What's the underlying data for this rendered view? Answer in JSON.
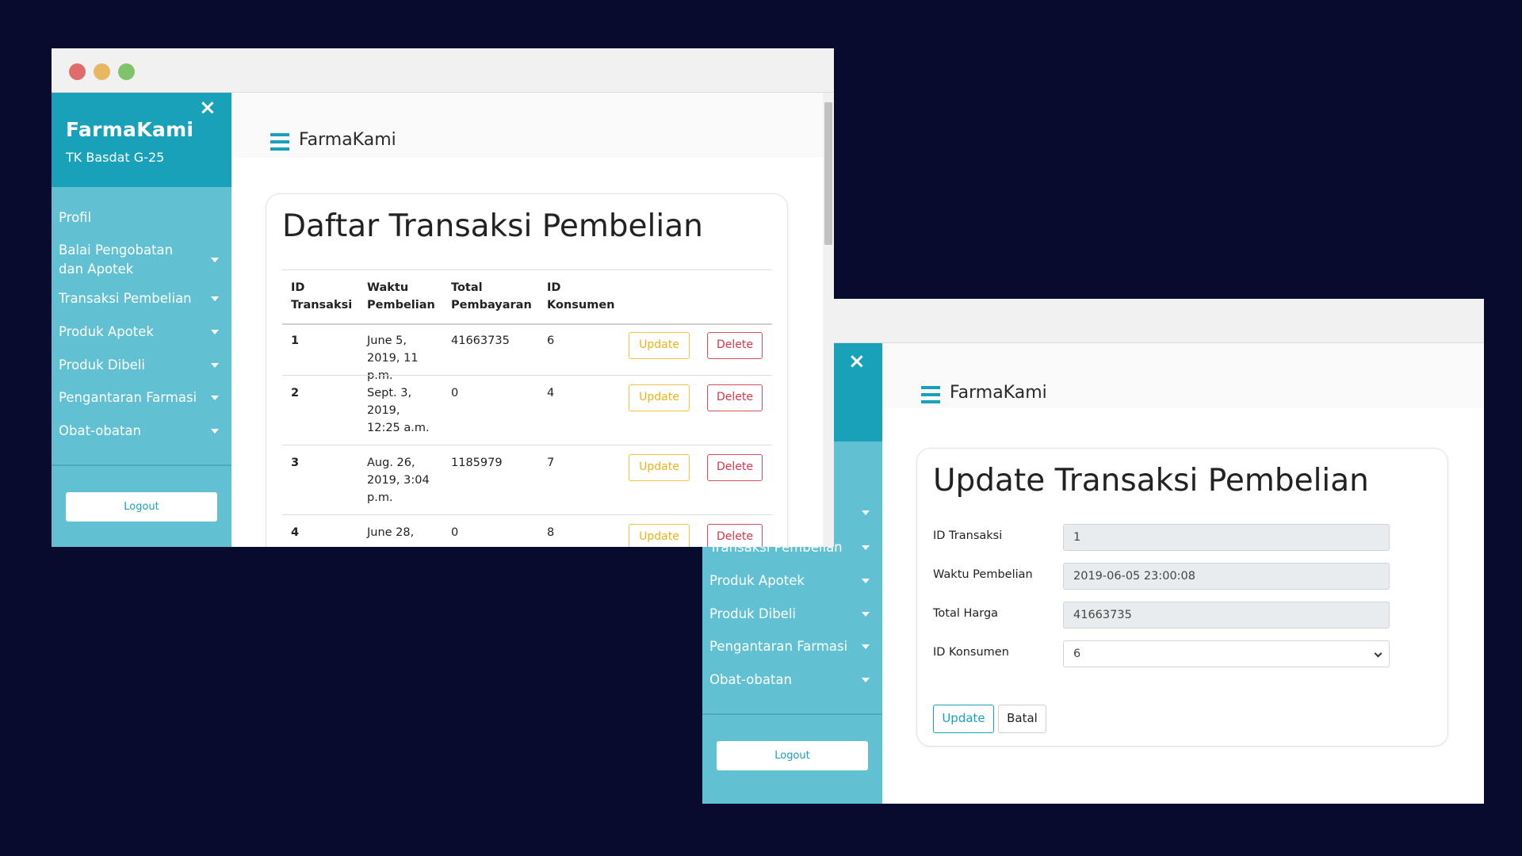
{
  "colors": {
    "background": "#070b2e",
    "sidebar_header": "#1aa1ba",
    "sidebar": "#61c1d2",
    "update_accent": "#f0b21a",
    "delete_accent": "#dc3545",
    "primary": "#1aa1ba"
  },
  "window_controls": [
    "close-dot",
    "minimize-dot",
    "maximize-dot"
  ],
  "list_window": {
    "sidebar": {
      "brand": "FarmaKami",
      "subtitle": "TK Basdat G-25",
      "close_icon": "×",
      "menu": [
        {
          "label": "Profil",
          "has_caret": false
        },
        {
          "label": "Balai Pengobatan dan Apotek",
          "has_caret": true
        },
        {
          "label": "Transaksi Pembelian",
          "has_caret": true
        },
        {
          "label": "Produk Apotek",
          "has_caret": true
        },
        {
          "label": "Produk Dibeli",
          "has_caret": true
        },
        {
          "label": "Pengantaran Farmasi",
          "has_caret": true
        },
        {
          "label": "Obat-obatan",
          "has_caret": true
        }
      ],
      "logout": "Logout"
    },
    "header": {
      "app_name": "FarmaKami",
      "icon": "menu-lines-icon"
    },
    "page_title": "Daftar Transaksi Pembelian",
    "table": {
      "columns": [
        "ID Transaksi",
        "Waktu Pembelian",
        "Total Pembayaran",
        "ID Konsumen"
      ],
      "rows": [
        {
          "id": "1",
          "waktu": "June 5, 2019, 11 p.m.",
          "total": "41663735",
          "konsumen": "6"
        },
        {
          "id": "2",
          "waktu": "Sept. 3, 2019, 12:25 a.m.",
          "total": "0",
          "konsumen": "4"
        },
        {
          "id": "3",
          "waktu": "Aug. 26, 2019, 3:04 p.m.",
          "total": "1185979",
          "konsumen": "7"
        },
        {
          "id": "4",
          "waktu": "June 28,",
          "total": "0",
          "konsumen": "8"
        }
      ],
      "update_label": "Update",
      "delete_label": "Delete"
    }
  },
  "update_window": {
    "sidebar": {
      "close_icon": "×",
      "menu": [
        {
          "label": "Transaksi Pembelian"
        },
        {
          "label": "Produk Apotek"
        },
        {
          "label": "Produk Dibeli"
        },
        {
          "label": "Pengantaran Farmasi"
        },
        {
          "label": "Obat-obatan"
        }
      ],
      "logout": "Logout"
    },
    "header": {
      "app_name": "FarmaKami",
      "icon": "menu-lines-icon"
    },
    "page_title": "Update Transaksi Pembelian",
    "form": {
      "id_transaksi": {
        "label": "ID Transaksi",
        "value": "1"
      },
      "waktu_pembelian": {
        "label": "Waktu Pembelian",
        "value": "2019-06-05 23:00:08"
      },
      "total_harga": {
        "label": "Total Harga",
        "value": "41663735"
      },
      "id_konsumen": {
        "label": "ID Konsumen",
        "value": "6"
      },
      "update_button": "Update",
      "cancel_button": "Batal"
    }
  }
}
